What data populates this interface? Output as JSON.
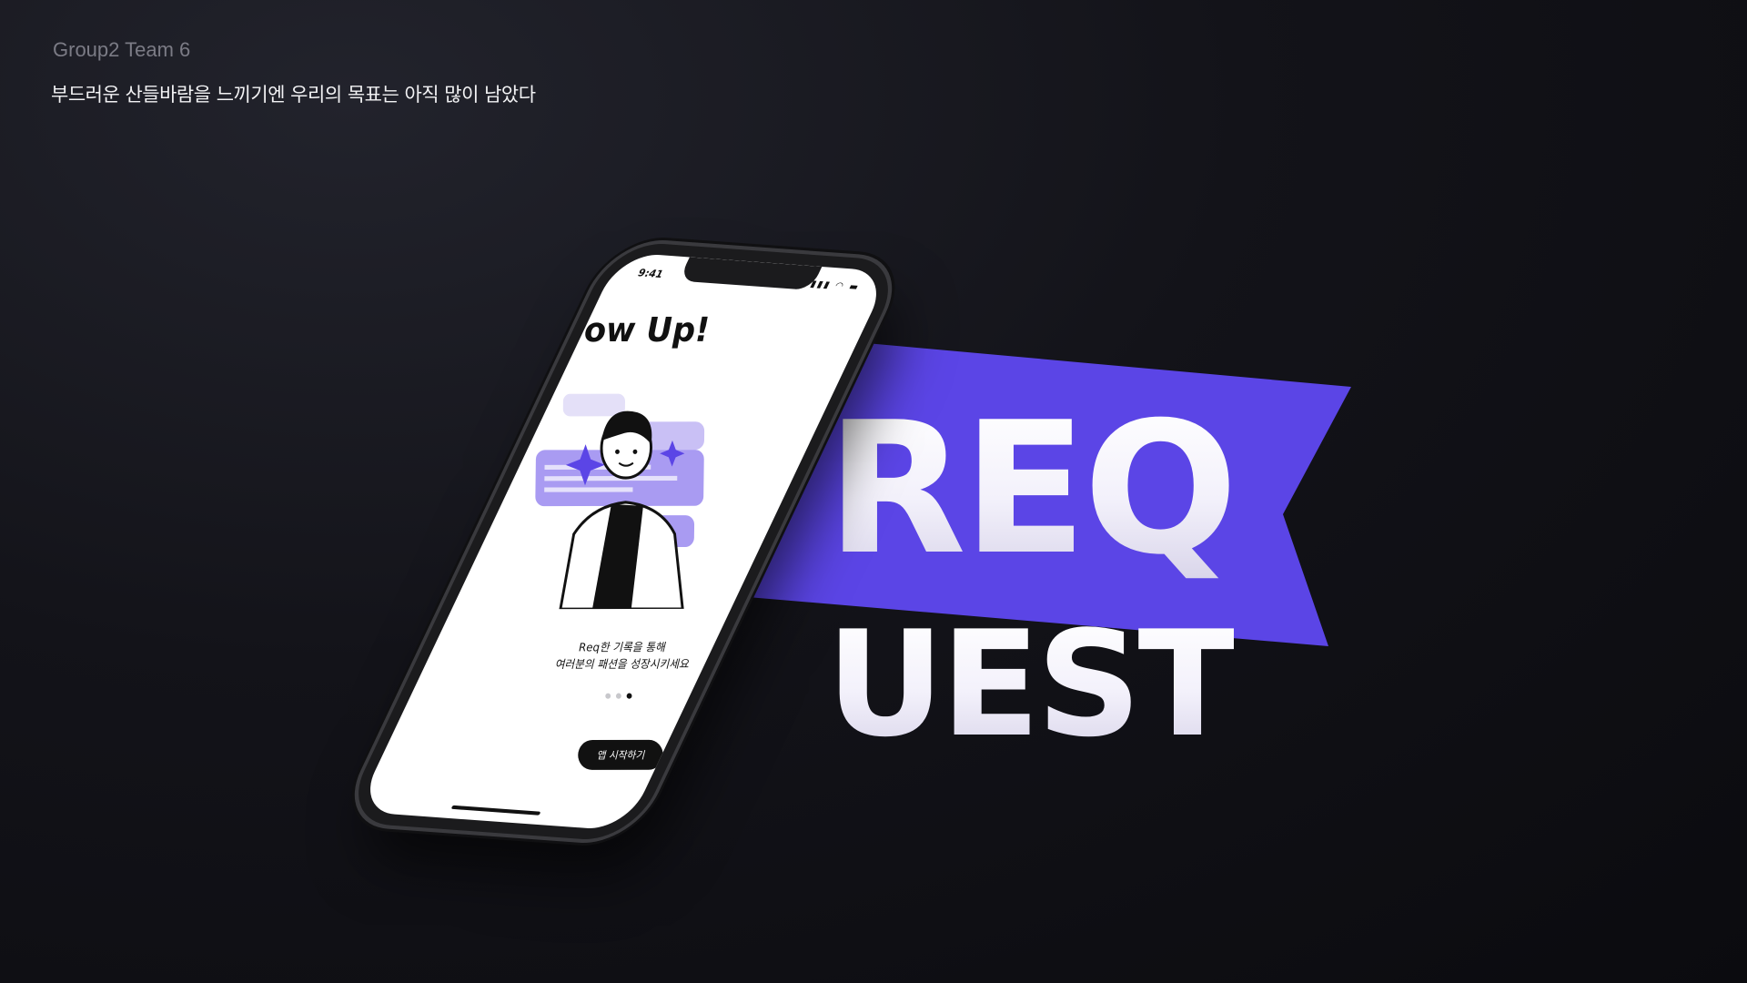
{
  "header": {
    "team": "Group2 Team 6",
    "tagline": "부드러운 산들바람을 느끼기엔 우리의 목표는 아직 많이 남았다"
  },
  "logo": {
    "top": "REQ",
    "bottom": "UEST",
    "banner_color": "#5b45e6"
  },
  "phone": {
    "status_time": "9:41",
    "title": "Grow Up!",
    "description_line1": "Req한 기록을 통해",
    "description_line2": "여러분의 패션을 성장시키세요",
    "page_indicator": {
      "total": 3,
      "active": 3
    },
    "start_button": "앱 시작하기"
  }
}
